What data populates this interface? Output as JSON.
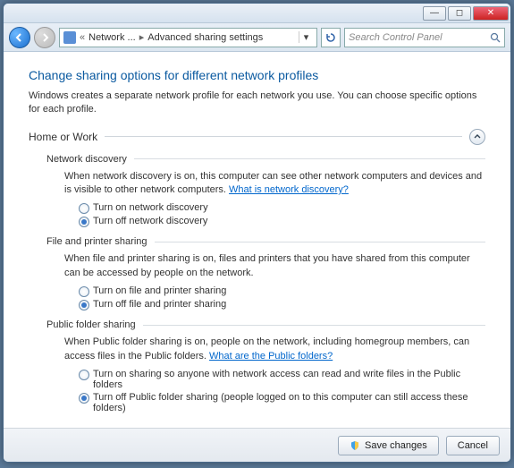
{
  "breadcrumb": {
    "part1": "Network ...",
    "part2": "Advanced sharing settings"
  },
  "search": {
    "placeholder": "Search Control Panel"
  },
  "page": {
    "title": "Change sharing options for different network profiles",
    "description": "Windows creates a separate network profile for each network you use. You can choose specific options for each profile."
  },
  "profile": {
    "label": "Home or Work"
  },
  "sections": {
    "discovery": {
      "title": "Network discovery",
      "body_pre": "When network discovery is on, this computer can see other network computers and devices and is visible to other network computers. ",
      "link": "What is network discovery?",
      "opt_on": "Turn on network discovery",
      "opt_off": "Turn off network discovery",
      "selected": "off"
    },
    "fileprint": {
      "title": "File and printer sharing",
      "body": "When file and printer sharing is on, files and printers that you have shared from this computer can be accessed by people on the network.",
      "opt_on": "Turn on file and printer sharing",
      "opt_off": "Turn off file and printer sharing",
      "selected": "off"
    },
    "publicfolder": {
      "title": "Public folder sharing",
      "body_pre": "When Public folder sharing is on, people on the network, including homegroup members, can access files in the Public folders. ",
      "link": "What are the Public folders?",
      "opt_on": "Turn on sharing so anyone with network access can read and write files in the Public folders",
      "opt_off": "Turn off Public folder sharing (people logged on to this computer can still access these folders)",
      "selected": "off"
    }
  },
  "buttons": {
    "save": "Save changes",
    "cancel": "Cancel"
  }
}
